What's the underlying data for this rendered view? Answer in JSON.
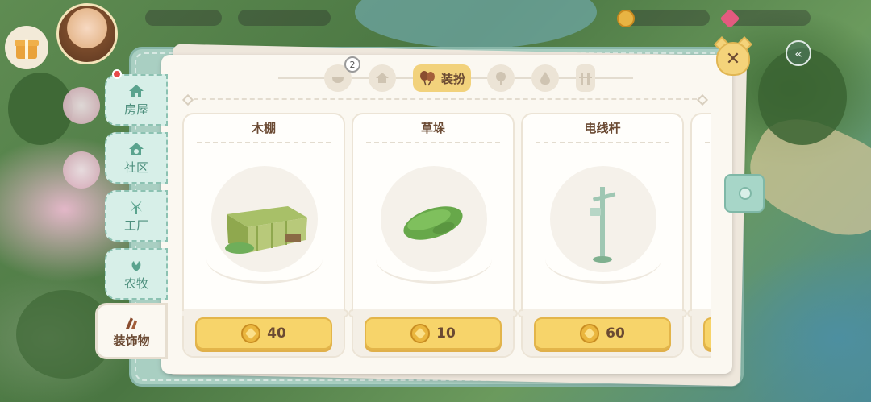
{
  "side_tabs": [
    {
      "label": "房屋",
      "icon": "house-icon"
    },
    {
      "label": "社区",
      "icon": "community-icon"
    },
    {
      "label": "工厂",
      "icon": "windmill-icon"
    },
    {
      "label": "农牧",
      "icon": "farm-icon"
    },
    {
      "label": "装饰物",
      "icon": "decoration-icon",
      "active": true
    }
  ],
  "categories": {
    "badge_count": "2",
    "active_label": "装扮",
    "icons": [
      "bowl-icon",
      "house-outline-icon",
      "balloon-icon",
      "tree-icon",
      "drop-icon",
      "fence-icon"
    ]
  },
  "items": [
    {
      "name": "木棚",
      "price": "40",
      "icon": "wooden-shed-icon"
    },
    {
      "name": "草垛",
      "price": "10",
      "icon": "hay-bale-icon"
    },
    {
      "name": "电线杆",
      "price": "60",
      "icon": "utility-pole-icon"
    }
  ],
  "colors": {
    "accent": "#f7d46a",
    "tab_green": "#d7efe8",
    "text_brown": "#6b4a33",
    "notification": "#e84a4a"
  }
}
